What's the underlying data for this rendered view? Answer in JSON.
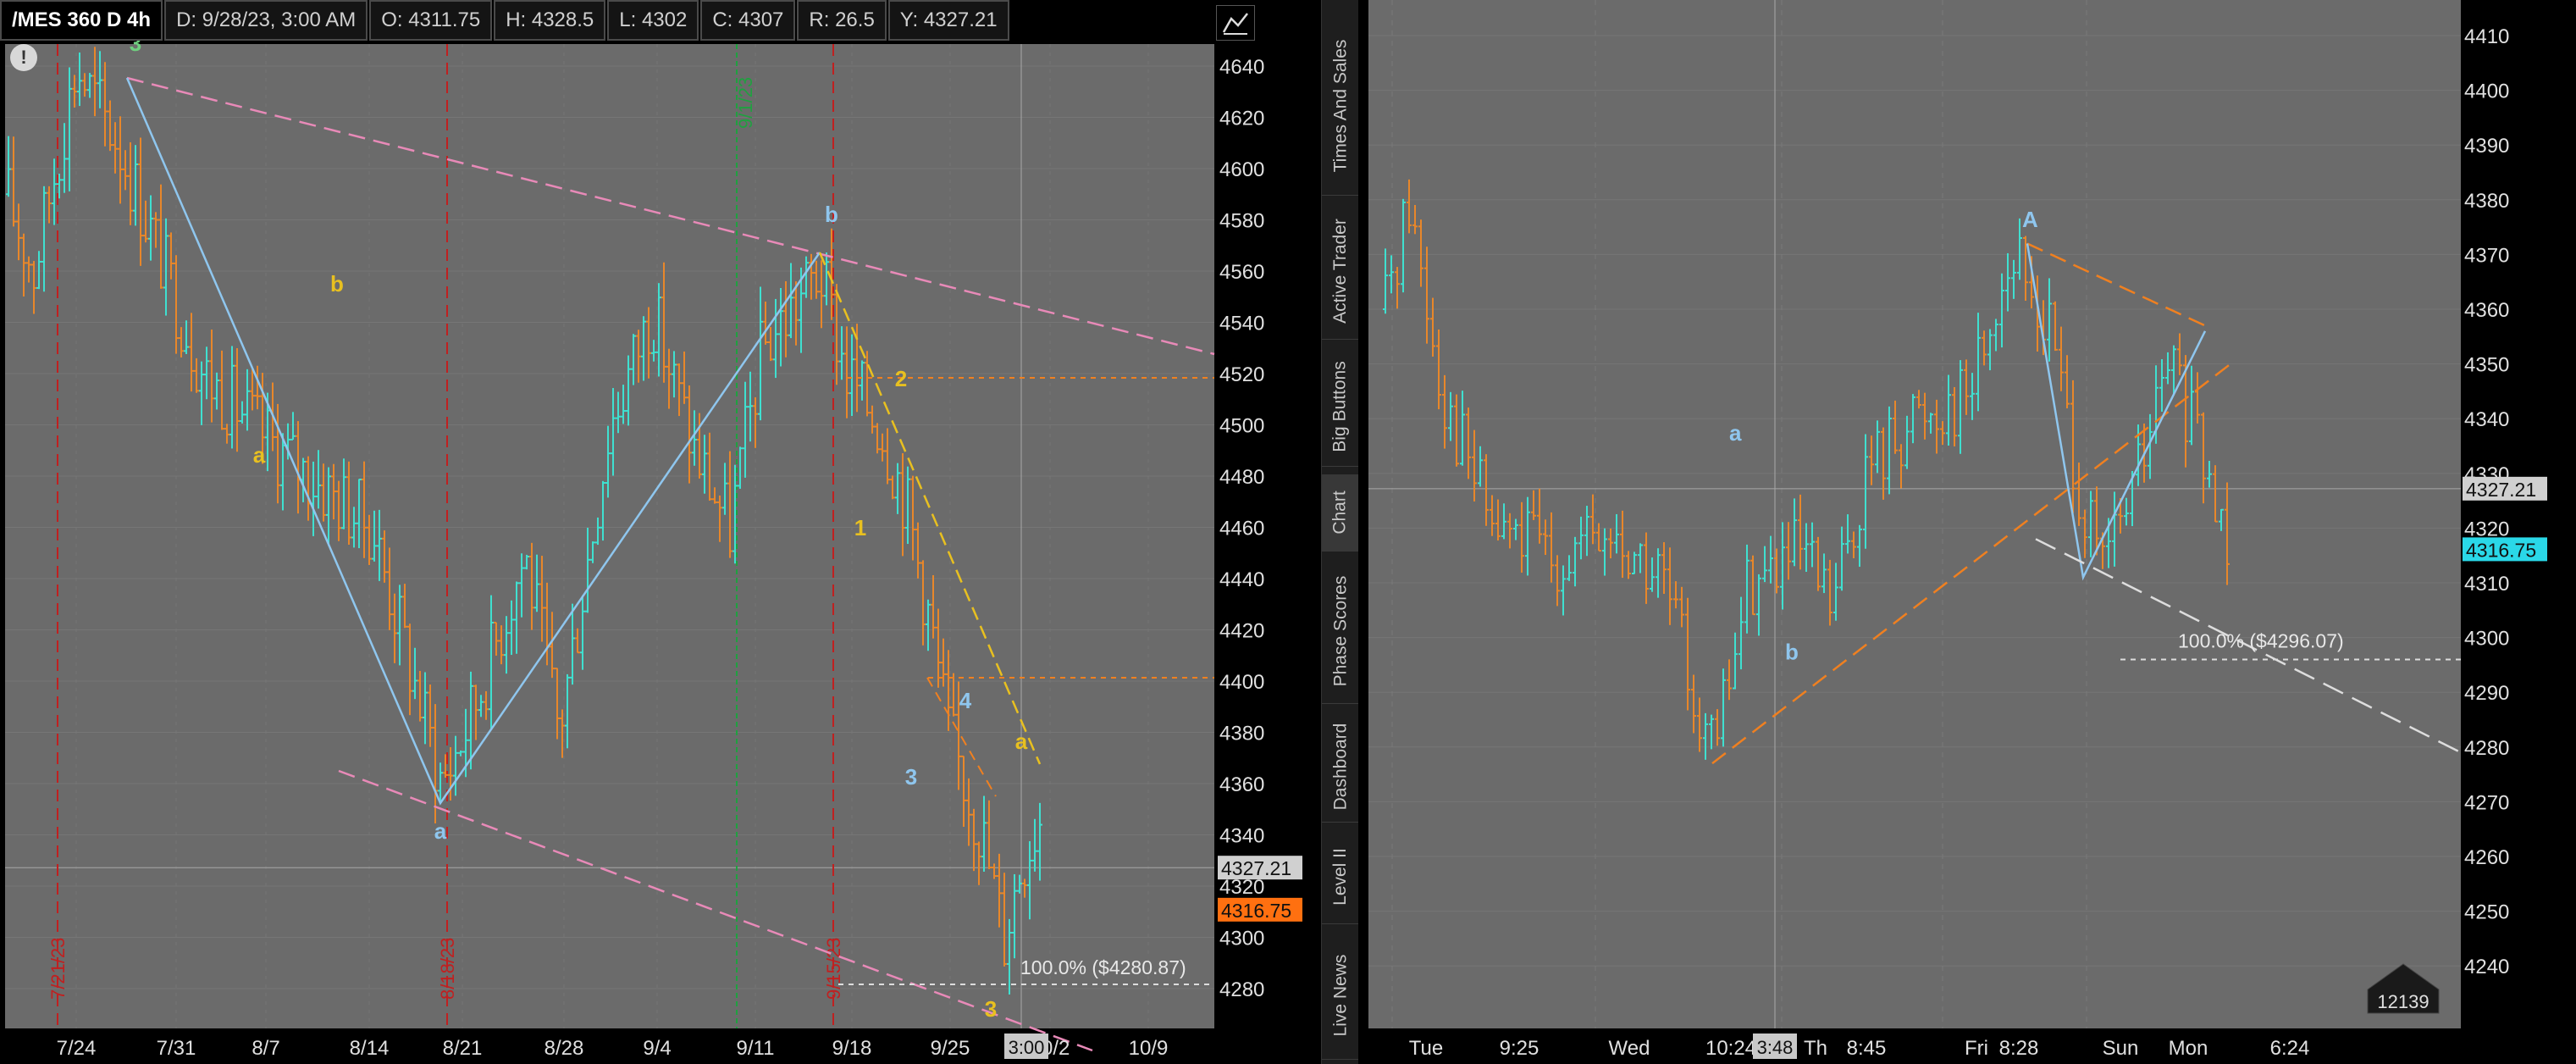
{
  "left_chart": {
    "info": {
      "symbol": "/MES 360 D 4h",
      "date": "D: 9/28/23, 3:00 AM",
      "open": "O: 4311.75",
      "high": "H: 4328.5",
      "low": "L: 4302",
      "close": "C: 4307",
      "range": "R: 26.5",
      "cursor_y": "Y: 4327.21"
    },
    "alert_icon": "!",
    "price_axis": [
      "4640",
      "4620",
      "4600",
      "4580",
      "4560",
      "4540",
      "4520",
      "4500",
      "4480",
      "4460",
      "4440",
      "4420",
      "4400",
      "4380",
      "4360",
      "4340",
      "4320",
      "4300",
      "4280"
    ],
    "cursor_price": "4327.21",
    "last_price": "4316.75",
    "time_axis": [
      "7/24",
      "7/31",
      "8/7",
      "8/14",
      "8/21",
      "8/28",
      "9/4",
      "9/11",
      "9/18",
      "9/25",
      "10/2",
      "10/9"
    ],
    "cursor_time": "3:00",
    "event_labels": [
      "7/21/23",
      "8/18/23",
      "9/15/23",
      "9/1/23"
    ],
    "wave_labels": {
      "w3_top": "3",
      "b_left": "b",
      "a_left": "a",
      "a_bottom": "a",
      "b_top": "b",
      "w2": "2",
      "w1": "1",
      "w3_mid": "3",
      "w4": "4",
      "w_a_right": "a",
      "w3_bottom": "3"
    },
    "fib_label": "100.0%  ($4280.87)"
  },
  "right_chart": {
    "price_axis": [
      "4410",
      "4400",
      "4390",
      "4380",
      "4370",
      "4360",
      "4350",
      "4340",
      "4330",
      "4320",
      "4310",
      "4300",
      "4290",
      "4280",
      "4270",
      "4260",
      "4250",
      "4240"
    ],
    "cursor_price": "4327.21",
    "last_price": "4316.75",
    "time_axis": [
      "Tue",
      "9:25",
      "Wed",
      "10:24",
      "Th",
      "8:45",
      "Fri",
      "8:28",
      "Sun",
      "Mon",
      "6:24"
    ],
    "cursor_time": "3:48",
    "wave_labels": {
      "a": "a",
      "b": "b",
      "A": "A"
    },
    "fib_label": "100.0%  ($4296.07)",
    "tick_count": "12139"
  },
  "side_tabs": [
    "Times And Sales",
    "Active Trader",
    "Big Buttons",
    "Chart",
    "Phase Scores",
    "Dashboard",
    "Level II",
    "Live News"
  ],
  "colors": {
    "bg": "#6b6b6b",
    "up": "#3fe0d0",
    "down": "#e8872a",
    "pink": "#e88ab8",
    "zig": "#8fc6ee",
    "yellow": "#e8c020",
    "orange_dash": "#f08020",
    "last_price_left": "#ff7010",
    "last_price_right": "#2ad8e8"
  }
}
